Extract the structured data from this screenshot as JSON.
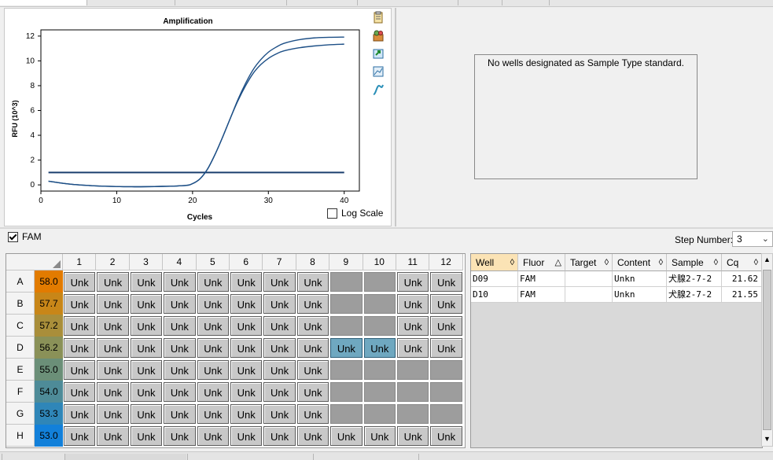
{
  "chart_data": {
    "type": "line",
    "title": "Amplification",
    "xlabel": "Cycles",
    "ylabel": "RFU (10^3)",
    "xlim": [
      0,
      42
    ],
    "ylim": [
      -0.5,
      12.5
    ],
    "xticks": [
      0,
      10,
      20,
      30,
      40
    ],
    "yticks": [
      0,
      2,
      4,
      6,
      8,
      10,
      12
    ],
    "grid": true,
    "threshold": 1.0,
    "series": [
      {
        "x": [
          1,
          4,
          8,
          12,
          16,
          19,
          20,
          21,
          22,
          23,
          24,
          25,
          26,
          27,
          28,
          29,
          30,
          31,
          32,
          34,
          36,
          38,
          40
        ],
        "y": [
          0.3,
          0.05,
          -0.1,
          -0.15,
          -0.12,
          -0.05,
          0.1,
          0.5,
          1.3,
          2.5,
          3.9,
          5.4,
          6.9,
          8.2,
          9.3,
          10.1,
          10.7,
          11.1,
          11.4,
          11.7,
          11.85,
          11.9,
          11.92
        ]
      },
      {
        "x": [
          1,
          4,
          8,
          12,
          16,
          19,
          20,
          21,
          22,
          23,
          24,
          25,
          26,
          27,
          28,
          29,
          30,
          31,
          32,
          34,
          36,
          38,
          40
        ],
        "y": [
          0.3,
          0.05,
          -0.1,
          -0.15,
          -0.12,
          -0.05,
          0.1,
          0.5,
          1.3,
          2.5,
          3.9,
          5.4,
          6.8,
          8.0,
          9.0,
          9.7,
          10.2,
          10.55,
          10.8,
          11.05,
          11.2,
          11.3,
          11.35
        ]
      }
    ]
  },
  "log_scale_label": "Log Scale",
  "std_message": "No wells designated as Sample Type standard.",
  "fam_label": "FAM",
  "step_label": "Step Number:",
  "step_value": "3",
  "plate": {
    "columns": [
      "1",
      "2",
      "3",
      "4",
      "5",
      "6",
      "7",
      "8",
      "9",
      "10",
      "11",
      "12"
    ],
    "rows": [
      {
        "label": "A",
        "temp": "58.0",
        "color": "#e27b00",
        "wells": [
          "Unk",
          "Unk",
          "Unk",
          "Unk",
          "Unk",
          "Unk",
          "Unk",
          "Unk",
          "",
          "",
          "Unk",
          "Unk"
        ]
      },
      {
        "label": "B",
        "temp": "57.7",
        "color": "#c88618",
        "wells": [
          "Unk",
          "Unk",
          "Unk",
          "Unk",
          "Unk",
          "Unk",
          "Unk",
          "Unk",
          "",
          "",
          "Unk",
          "Unk"
        ]
      },
      {
        "label": "C",
        "temp": "57.2",
        "color": "#a98e3a",
        "wells": [
          "Unk",
          "Unk",
          "Unk",
          "Unk",
          "Unk",
          "Unk",
          "Unk",
          "Unk",
          "",
          "",
          "Unk",
          "Unk"
        ]
      },
      {
        "label": "D",
        "temp": "56.2",
        "color": "#8a9158",
        "wells": [
          "Unk",
          "Unk",
          "Unk",
          "Unk",
          "Unk",
          "Unk",
          "Unk",
          "Unk",
          "Unk",
          "Unk",
          "Unk",
          "Unk"
        ]
      },
      {
        "label": "E",
        "temp": "55.0",
        "color": "#6b8f78",
        "wells": [
          "Unk",
          "Unk",
          "Unk",
          "Unk",
          "Unk",
          "Unk",
          "Unk",
          "Unk",
          "",
          "",
          "",
          ""
        ]
      },
      {
        "label": "F",
        "temp": "54.0",
        "color": "#4e8b98",
        "wells": [
          "Unk",
          "Unk",
          "Unk",
          "Unk",
          "Unk",
          "Unk",
          "Unk",
          "Unk",
          "",
          "",
          "",
          ""
        ]
      },
      {
        "label": "G",
        "temp": "53.3",
        "color": "#2f86b8",
        "wells": [
          "Unk",
          "Unk",
          "Unk",
          "Unk",
          "Unk",
          "Unk",
          "Unk",
          "Unk",
          "",
          "",
          "",
          ""
        ]
      },
      {
        "label": "H",
        "temp": "53.0",
        "color": "#1280da",
        "wells": [
          "Unk",
          "Unk",
          "Unk",
          "Unk",
          "Unk",
          "Unk",
          "Unk",
          "Unk",
          "Unk",
          "Unk",
          "Unk",
          "Unk"
        ]
      }
    ],
    "selected": [
      "D9",
      "D10"
    ]
  },
  "table": {
    "headers": [
      "Well",
      "Fluor",
      "Target",
      "Content",
      "Sample",
      "Cq"
    ],
    "rows": [
      [
        "D09",
        "FAM",
        "",
        "Unkn",
        "犬腺2-7-2",
        "21.62"
      ],
      [
        "D10",
        "FAM",
        "",
        "Unkn",
        "犬腺2-7-2",
        "21.55"
      ]
    ]
  },
  "icons": [
    "clipboard-icon",
    "plate-setup-icon",
    "export-icon",
    "chart-settings-icon",
    "curve-icon"
  ]
}
